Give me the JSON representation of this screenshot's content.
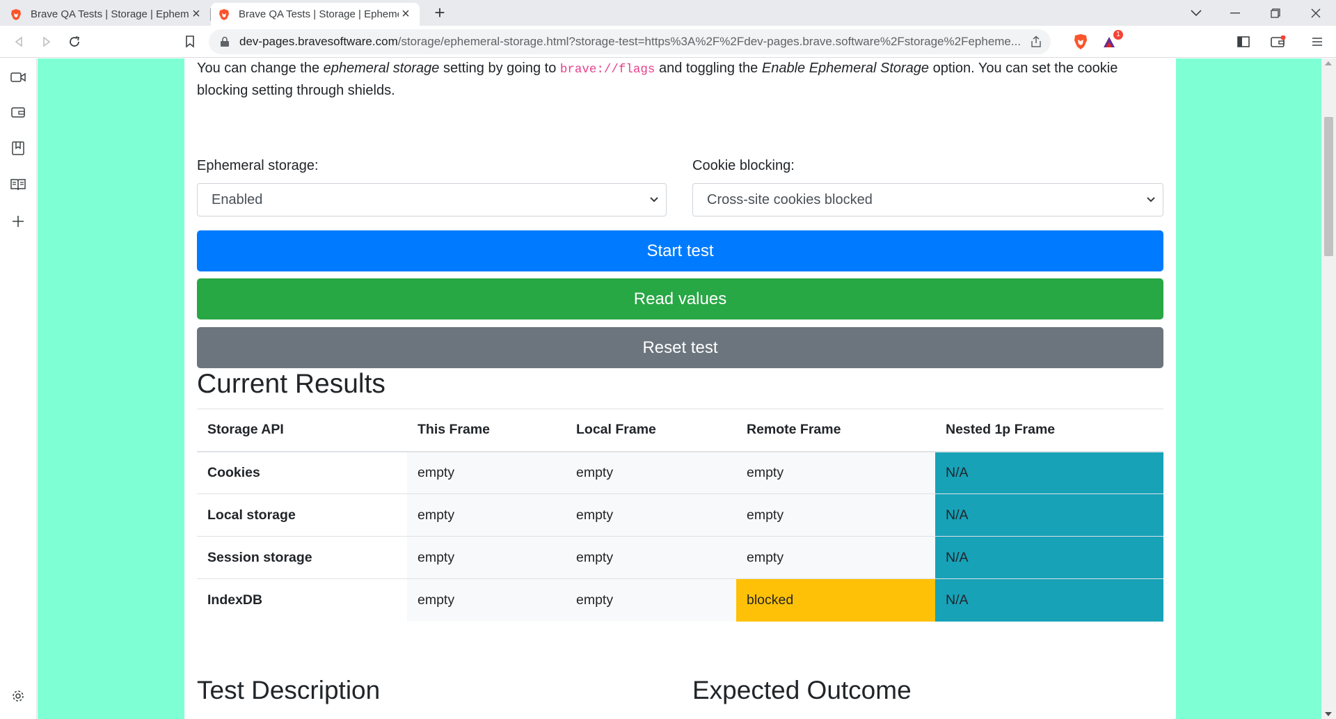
{
  "browser": {
    "tabs": [
      {
        "title": "Brave QA Tests | Storage | Ephemeral Storage",
        "active": false
      },
      {
        "title": "Brave QA Tests | Storage | Ephemeral Storage",
        "active": true
      }
    ],
    "url": {
      "host": "dev-pages.bravesoftware.com",
      "path": "/storage/ephemeral-storage.html?storage-test=https%3A%2F%2Fdev-pages.brave.software%2Fstorage%2Fepheme..."
    },
    "rewards_badge": "1",
    "colors": {
      "brave_orange": "#fb542b",
      "badge": "#f44336",
      "bat_red": "#e22919",
      "bat_purple": "#662d91"
    }
  },
  "page": {
    "intro": {
      "t1": "You can change the ",
      "em1": "ephemeral storage",
      "t2": " setting by going to ",
      "code": "brave://flags",
      "t3": " and toggling the ",
      "em2": "Enable Ephemeral Storage",
      "t4": " option. You can set the cookie blocking setting through shields."
    },
    "ephemeral": {
      "label": "Ephemeral storage:",
      "selected": "Enabled"
    },
    "cookie": {
      "label": "Cookie blocking:",
      "selected": "Cross-site cookies blocked"
    },
    "buttons": {
      "start": "Start test",
      "read": "Read values",
      "reset": "Reset test"
    },
    "results": {
      "heading": "Current Results",
      "columns": [
        "Storage API",
        "This Frame",
        "Local Frame",
        "Remote Frame",
        "Nested 1p Frame"
      ],
      "rows": [
        {
          "api": "Cookies",
          "this": "empty",
          "local": "empty",
          "remote": "empty",
          "nested": "N/A"
        },
        {
          "api": "Local storage",
          "this": "empty",
          "local": "empty",
          "remote": "empty",
          "nested": "N/A"
        },
        {
          "api": "Session storage",
          "this": "empty",
          "local": "empty",
          "remote": "empty",
          "nested": "N/A"
        },
        {
          "api": "IndexDB",
          "this": "empty",
          "local": "empty",
          "remote": "blocked",
          "nested": "N/A"
        }
      ]
    },
    "sections": {
      "description": "Test Description",
      "outcome": "Expected Outcome"
    },
    "colors": {
      "page_bg": "#7fffd4",
      "primary": "#007bff",
      "success": "#28a745",
      "secondary": "#6c757d",
      "info": "#17a2b8",
      "warning": "#ffc107"
    }
  }
}
